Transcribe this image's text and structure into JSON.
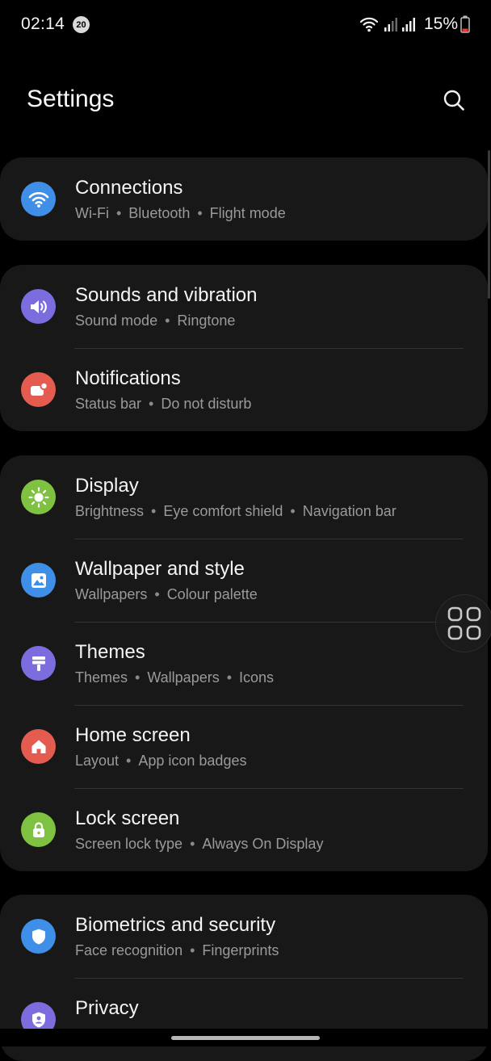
{
  "status_bar": {
    "time": "02:14",
    "notification_count": "20",
    "battery": "15%"
  },
  "header": {
    "title": "Settings"
  },
  "colors": {
    "connections": "#3f8ee8",
    "sounds": "#7c6ddf",
    "notifications": "#e45c4f",
    "display": "#7fc242",
    "wallpaper": "#3f8ee8",
    "themes": "#7c6ddf",
    "home_screen": "#e45c4f",
    "lock_screen": "#7fc242",
    "biometrics": "#3f8ee8",
    "privacy": "#7c6ddf"
  },
  "groups": [
    {
      "items": [
        {
          "title": "Connections",
          "icon": "wifi-icon",
          "subs": [
            "Wi-Fi",
            "Bluetooth",
            "Flight mode"
          ]
        }
      ]
    },
    {
      "items": [
        {
          "title": "Sounds and vibration",
          "icon": "speaker-icon",
          "subs": [
            "Sound mode",
            "Ringtone"
          ]
        },
        {
          "title": "Notifications",
          "icon": "notification-icon",
          "subs": [
            "Status bar",
            "Do not disturb"
          ]
        }
      ]
    },
    {
      "items": [
        {
          "title": "Display",
          "icon": "brightness-icon",
          "subs": [
            "Brightness",
            "Eye comfort shield",
            "Navigation bar"
          ]
        },
        {
          "title": "Wallpaper and style",
          "icon": "wallpaper-icon",
          "subs": [
            "Wallpapers",
            "Colour palette"
          ]
        },
        {
          "title": "Themes",
          "icon": "paintbrush-icon",
          "subs": [
            "Themes",
            "Wallpapers",
            "Icons"
          ]
        },
        {
          "title": "Home screen",
          "icon": "home-icon",
          "subs": [
            "Layout",
            "App icon badges"
          ]
        },
        {
          "title": "Lock screen",
          "icon": "lock-icon",
          "subs": [
            "Screen lock type",
            "Always On Display"
          ]
        }
      ]
    },
    {
      "items": [
        {
          "title": "Biometrics and security",
          "icon": "shield-icon",
          "subs": [
            "Face recognition",
            "Fingerprints"
          ]
        },
        {
          "title": "Privacy",
          "icon": "privacy-icon",
          "subs": []
        }
      ]
    }
  ]
}
